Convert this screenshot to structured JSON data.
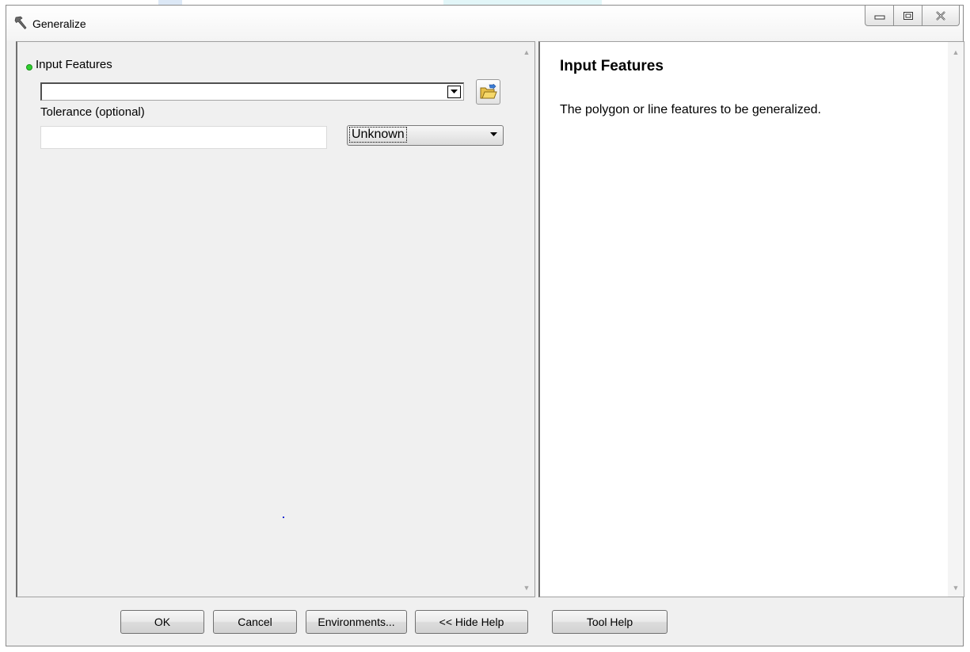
{
  "window": {
    "title": "Generalize",
    "icon": "hammer-icon",
    "controls": [
      "minimize-icon",
      "restore-icon",
      "close-icon"
    ]
  },
  "form": {
    "input_features": {
      "label": "Input Features",
      "required_indicator_color": "#2fd12f",
      "value": "",
      "browse_icon": "open-folder-icon"
    },
    "tolerance": {
      "label": "Tolerance (optional)",
      "value": "",
      "unit": "Unknown"
    }
  },
  "help": {
    "title": "Input Features",
    "text": "The polygon or line features to be generalized."
  },
  "buttons": {
    "ok": "OK",
    "cancel": "Cancel",
    "environments": "Environments...",
    "hide_help": "<< Hide Help",
    "tool_help": "Tool Help"
  }
}
